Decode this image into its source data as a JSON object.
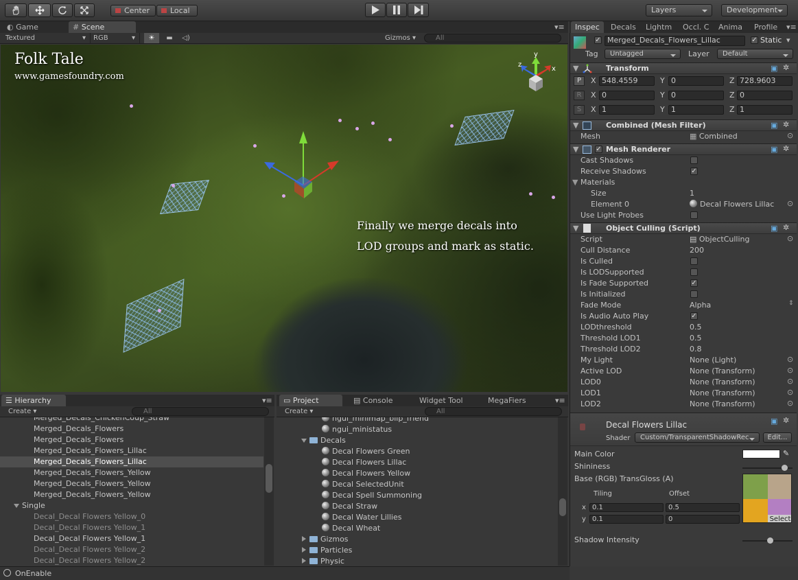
{
  "toolbar": {
    "pivot": "Center",
    "space": "Local",
    "layers": "Layers",
    "layout": "Development"
  },
  "scene_tabs": {
    "game": "Game",
    "scene": "Scene",
    "render_mode": "Textured",
    "color_mode": "RGB",
    "gizmos": "Gizmos",
    "search": "All"
  },
  "overlay": {
    "title": "Folk Tale",
    "site": "www.gamesfoundry.com",
    "caption_line1": "Finally we merge decals into",
    "caption_line2": "LOD groups and mark as static."
  },
  "gizmo": {
    "y": "y",
    "x": "x",
    "z": "z"
  },
  "hierarchy": {
    "tab": "Hierarchy",
    "create": "Create",
    "search": "All",
    "rows": [
      "Merged_Decals_ChickenCoup_Straw",
      "Merged_Decals_Flowers",
      "Merged_Decals_Flowers",
      "Merged_Decals_Flowers_Lillac",
      "Merged_Decals_Flowers_Lillac",
      "Merged_Decals_Flowers_Yellow",
      "Merged_Decals_Flowers_Yellow",
      "Merged_Decals_Flowers_Yellow"
    ],
    "group": "Single",
    "child_rows": [
      "Decal_Decal Flowers Yellow_0",
      "Decal_Decal Flowers Yellow_1",
      "Decal_Decal Flowers Yellow_1",
      "Decal_Decal Flowers Yellow_2",
      "Decal_Decal Flowers Yellow_2"
    ]
  },
  "project": {
    "tabs": [
      "Project",
      "Console",
      "Widget Tool",
      "MegaFiers"
    ],
    "create": "Create",
    "search": "All",
    "top_rows": [
      "ngui_minimap_blip_friend",
      "ngui_ministatus"
    ],
    "folder": "Decals",
    "items": [
      "Decal Flowers Green",
      "Decal Flowers Lillac",
      "Decal Flowers Yellow",
      "Decal SelectedUnit",
      "Decal Spell Summoning",
      "Decal Straw",
      "Decal Water Lillies",
      "Decal Wheat"
    ],
    "folders": [
      "Gizmos",
      "Particles",
      "Physic"
    ]
  },
  "status": {
    "text": "OnEnable"
  },
  "inspector": {
    "tabs": [
      "Inspec",
      "Decals",
      "Lightm",
      "Occl. C",
      "Anima",
      "Profile"
    ],
    "object_name": "Merged_Decals_Flowers_Lillac",
    "static_label": "Static",
    "tag_label": "Tag",
    "tag": "Untagged",
    "layer_label": "Layer",
    "layer": "Default",
    "transform": {
      "title": "Transform",
      "position": {
        "btn": "P",
        "x": "548.4559",
        "y": "0",
        "z": "728.9603"
      },
      "rotation": {
        "btn": "R",
        "x": "0",
        "y": "0",
        "z": "0"
      },
      "scale": {
        "btn": "S",
        "x": "1",
        "y": "1",
        "z": "1"
      }
    },
    "mesh_filter": {
      "title": "Combined (Mesh Filter)",
      "mesh_label": "Mesh",
      "mesh_value": "Combined"
    },
    "mesh_renderer": {
      "title": "Mesh Renderer",
      "cast": "Cast Shadows",
      "receive": "Receive Shadows",
      "materials": "Materials",
      "size_label": "Size",
      "size": "1",
      "element_label": "Element 0",
      "element": "Decal Flowers Lillac",
      "probes": "Use Light Probes"
    },
    "culling": {
      "title": "Object Culling (Script)",
      "rows": [
        {
          "label": "Script",
          "value": "ObjectCulling"
        },
        {
          "label": "Cull Distance",
          "value": "200"
        },
        {
          "label": "Is Culled",
          "value": ""
        },
        {
          "label": "Is LODSupported",
          "value": ""
        },
        {
          "label": "Is Fade Supported",
          "value": ""
        },
        {
          "label": "Is Initialized",
          "value": ""
        },
        {
          "label": "Fade Mode",
          "value": "Alpha"
        },
        {
          "label": "Is Audio Auto Play",
          "value": ""
        },
        {
          "label": "LODthreshold",
          "value": "0.5"
        },
        {
          "label": "Threshold LOD1",
          "value": "0.5"
        },
        {
          "label": "Threshold LOD2",
          "value": "0.8"
        },
        {
          "label": "My Light",
          "value": "None (Light)"
        },
        {
          "label": "Active LOD",
          "value": "None (Transform)"
        },
        {
          "label": "LOD0",
          "value": "None (Transform)"
        },
        {
          "label": "LOD1",
          "value": "None (Transform)"
        },
        {
          "label": "LOD2",
          "value": "None (Transform)"
        }
      ]
    },
    "material": {
      "name": "Decal Flowers Lillac",
      "shader_label": "Shader",
      "shader": "Custom/TransparentShadowRec",
      "edit": "Edit...",
      "main_color": "Main Color",
      "shininess": "Shininess",
      "base": "Base (RGB) TransGloss (A)",
      "tiling": "Tiling",
      "offset": "Offset",
      "x": "x",
      "y": "y",
      "tx": "0.1",
      "ox": "0.5",
      "ty": "0.1",
      "oy": "0",
      "select": "Select",
      "shadow": "Shadow Intensity"
    }
  }
}
